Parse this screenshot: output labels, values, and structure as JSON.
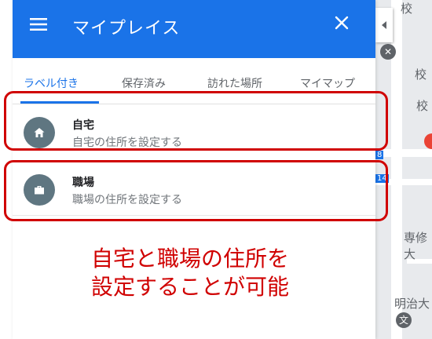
{
  "map": {
    "labels": [
      "校",
      "校",
      "校",
      "専修大",
      "明治大"
    ],
    "road_badges": [
      "8",
      "14"
    ]
  },
  "header": {
    "title": "マイプレイス",
    "menu_icon": "hamburger-menu-icon",
    "close_icon": "close-icon",
    "background": "#1a73e8"
  },
  "tabs": [
    {
      "label": "ラベル付き",
      "active": true
    },
    {
      "label": "保存済み",
      "active": false
    },
    {
      "label": "訪れた場所",
      "active": false
    },
    {
      "label": "マイマップ",
      "active": false
    }
  ],
  "places": [
    {
      "icon": "home-icon",
      "name": "自宅",
      "subtitle": "自宅の住所を設定する"
    },
    {
      "icon": "briefcase-icon",
      "name": "職場",
      "subtitle": "職場の住所を設定する"
    }
  ],
  "annotation": {
    "line1": "自宅と職場の住所を",
    "line2": "設定することが可能",
    "color": "#d00000"
  }
}
